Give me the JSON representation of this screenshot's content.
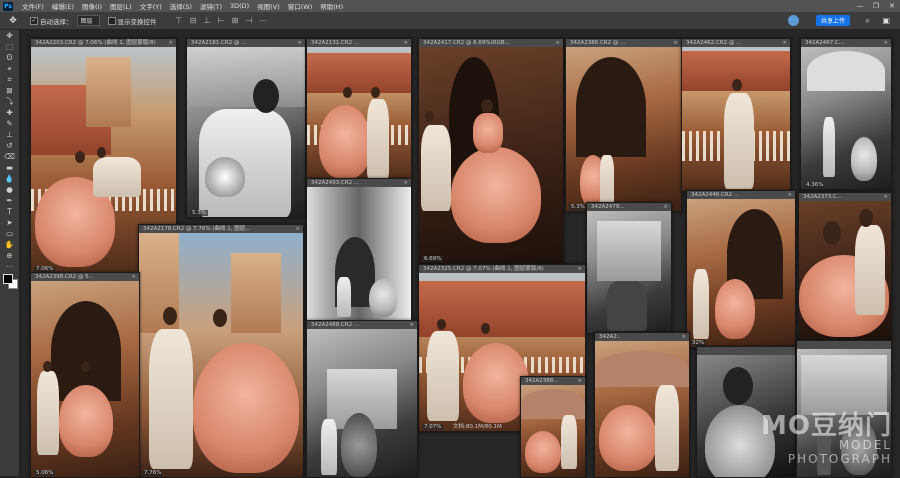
{
  "menubar": {
    "logo": "Ps",
    "items": [
      "文件(F)",
      "编辑(E)",
      "图像(I)",
      "图层(L)",
      "文字(Y)",
      "选择(S)",
      "滤镜(T)",
      "3D(D)",
      "视图(V)",
      "窗口(W)",
      "帮助(H)"
    ],
    "window_controls": [
      "—",
      "❐",
      "✕"
    ]
  },
  "options": {
    "auto_select_label": "自动选择：",
    "auto_select_value": "图层",
    "show_transform_label": "显示变换控件",
    "share_label": "共享上传"
  },
  "icons": {
    "move": "✥",
    "marquee": "⬚",
    "lasso": "ʘ",
    "quick_select": "⌖",
    "crop": "⌗",
    "frame": "⊠",
    "eyedropper": "⤵",
    "heal": "✚",
    "brush": "✎",
    "stamp": "⊥",
    "history": "↺",
    "eraser": "⌫",
    "gradient": "▬",
    "blur": "💧",
    "dodge": "●",
    "pen": "✒",
    "type": "T",
    "path_select": "➤",
    "shape": "▭",
    "hand": "✋",
    "zoom": "⊕",
    "more": "⋯"
  },
  "documents": [
    {
      "title": "342A2203.CR2 @ 7.06% (曲线 1, 图层蒙版/8)",
      "zoom": "7.06%"
    },
    {
      "title": "342A2181.CR2 @ ...",
      "zoom": "5.3%"
    },
    {
      "title": "342A2131.CR2 ...",
      "zoom": ""
    },
    {
      "title": "342A2417.CR2 @ 6.69%(RGB...",
      "zoom": "6.69%"
    },
    {
      "title": "342A2386.CR2 @ ...",
      "zoom": "5.3%"
    },
    {
      "title": "342A2462.CR2 @ ...",
      "zoom": ""
    },
    {
      "title": "342A2467.C...",
      "zoom": "4.36%"
    },
    {
      "title": "342A2493.CR2 ...",
      "zoom": ""
    },
    {
      "title": "342A2178.CR2 @ 7.76% (曲线 1, 图层...",
      "zoom": "7.76%"
    },
    {
      "title": "342A2398.CR2 @ 5...",
      "zoom": "5.06%"
    },
    {
      "title": "342A2479...",
      "zoom": ""
    },
    {
      "title": "342A2446.CR2 ...",
      "zoom": "32%"
    },
    {
      "title": "342A2373.C...",
      "zoom": ""
    },
    {
      "title": "342A2325.CR2 @ 7.07% (曲线 1, 图层蒙版/8)",
      "zoom": "7.07%",
      "status": "文档:80.1M/80.1M"
    },
    {
      "title": "342A2488.CR2 ...",
      "zoom": ""
    },
    {
      "title": "342A2388...",
      "zoom": ""
    },
    {
      "title": "342A2..",
      "zoom": ""
    },
    {
      "title": "",
      "zoom": ""
    },
    {
      "title": "",
      "zoom": ""
    }
  ],
  "watermark": {
    "main": "MO豆纳门",
    "sub": "MODEL PHOTOGRAPH"
  },
  "colors": {
    "accent": "#1473e6",
    "panel": "#3c3c3c",
    "canvas": "#262626"
  }
}
